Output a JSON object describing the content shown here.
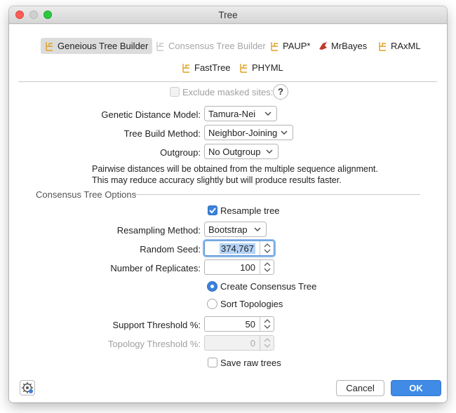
{
  "window": {
    "title": "Tree"
  },
  "programs": [
    {
      "label": "Geneious Tree Builder",
      "selected": true,
      "enabled": true,
      "icon": "tree-icon"
    },
    {
      "label": "Consensus Tree Builder",
      "selected": false,
      "enabled": false,
      "icon": "tree-icon"
    },
    {
      "label": "PAUP*",
      "selected": false,
      "enabled": true,
      "icon": "tree-icon"
    },
    {
      "label": "MrBayes",
      "selected": false,
      "enabled": true,
      "icon": "mrbayes-icon"
    },
    {
      "label": "RAxML",
      "selected": false,
      "enabled": true,
      "icon": "tree-icon"
    },
    {
      "label": "FastTree",
      "selected": false,
      "enabled": true,
      "icon": "tree-icon"
    },
    {
      "label": "PHYML",
      "selected": false,
      "enabled": true,
      "icon": "tree-icon"
    }
  ],
  "options": {
    "exclude_masked_sites": {
      "label": "Exclude masked sites:",
      "checked": false,
      "enabled": false
    },
    "help_label": "?",
    "genetic_distance_model": {
      "label": "Genetic Distance Model:",
      "value": "Tamura-Nei"
    },
    "tree_build_method": {
      "label": "Tree Build Method:",
      "value": "Neighbor-Joining"
    },
    "outgroup": {
      "label": "Outgroup:",
      "value": "No Outgroup"
    },
    "info_line1": "Pairwise distances will be obtained from the multiple sequence alignment.",
    "info_line2": "This may reduce accuracy slightly but will produce results faster."
  },
  "consensus": {
    "section_title": "Consensus Tree Options",
    "resample_tree": {
      "label": "Resample tree",
      "checked": true
    },
    "resampling_method": {
      "label": "Resampling Method:",
      "value": "Bootstrap"
    },
    "random_seed": {
      "label": "Random Seed:",
      "value": "374,767"
    },
    "number_of_replicates": {
      "label": "Number of Replicates:",
      "value": "100"
    },
    "create_consensus_tree": {
      "label": "Create Consensus Tree",
      "selected": true
    },
    "sort_topologies": {
      "label": "Sort Topologies",
      "selected": false
    },
    "support_threshold": {
      "label": "Support Threshold %:",
      "value": "50"
    },
    "topology_threshold": {
      "label": "Topology Threshold %:",
      "value": "0",
      "enabled": false
    },
    "save_raw_trees": {
      "label": "Save raw trees",
      "checked": false
    }
  },
  "footer": {
    "cancel_label": "Cancel",
    "ok_label": "OK"
  },
  "colors": {
    "accent": "#3f8be6",
    "tree_icon": "#e0a020",
    "mrbayes_icon": "#c0392b"
  }
}
